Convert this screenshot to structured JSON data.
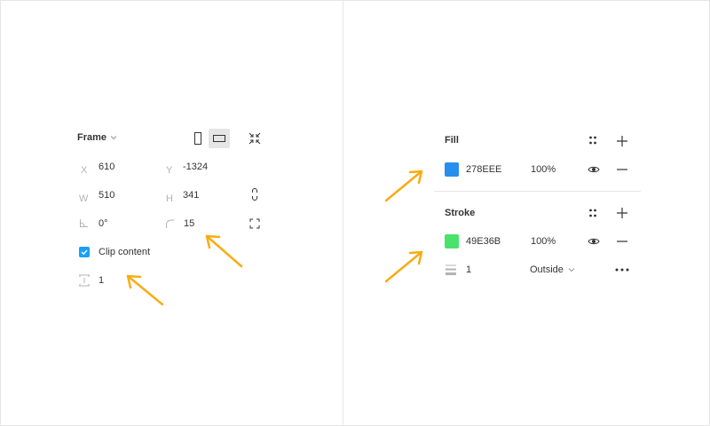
{
  "colors": {
    "accent": "#18a0fb",
    "arrow": "#f9ac13",
    "fill_swatch": "#278EEE",
    "stroke_swatch": "#49E36B"
  },
  "frame": {
    "title": "Frame",
    "x_label": "X",
    "x_value": "610",
    "y_label": "Y",
    "y_value": "-1324",
    "w_label": "W",
    "w_value": "510",
    "h_label": "H",
    "h_value": "341",
    "rotation_value": "0°",
    "radius_value": "15",
    "clip_content_label": "Clip content",
    "clip_content_checked": true,
    "spacing_value": "1"
  },
  "fill": {
    "title": "Fill",
    "hex": "278EEE",
    "opacity": "100%"
  },
  "stroke": {
    "title": "Stroke",
    "hex": "49E36B",
    "opacity": "100%",
    "weight": "1",
    "position": "Outside"
  }
}
